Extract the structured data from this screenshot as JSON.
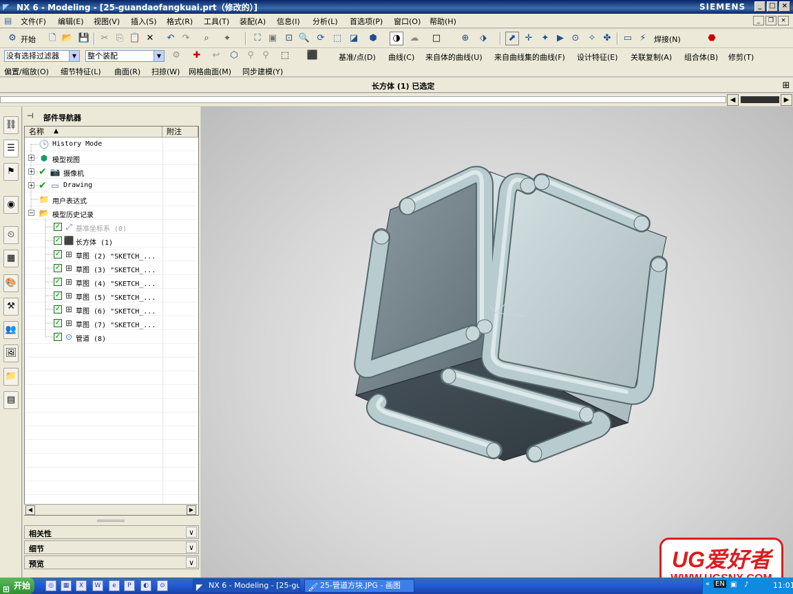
{
  "window": {
    "title": "NX 6 - Modeling - [25-guandaofangkuai.prt（修改的）]",
    "brand": "SIEMENS",
    "controls": [
      "_",
      "□",
      "×"
    ]
  },
  "menubar": {
    "items": [
      "文件(F)",
      "编辑(E)",
      "视图(V)",
      "插入(S)",
      "格式(R)",
      "工具(T)",
      "装配(A)",
      "信息(I)",
      "分析(L)",
      "首选项(P)",
      "窗口(O)",
      "帮助(H)"
    ]
  },
  "toolbar1": {
    "start_label": "开始",
    "weld_label": "焊接(N)"
  },
  "toolbar2": {
    "filter_combo": "没有选择过滤器",
    "assembly_combo": "整个装配",
    "items": [
      "基准/点(D)",
      "曲线(C)",
      "来自体的曲线(U)",
      "来自曲线集的曲线(F)",
      "设计特征(E)",
      "关联复制(A)",
      "组合体(B)",
      "修剪(T)"
    ]
  },
  "toolbar3": {
    "items": [
      "偏置/缩放(O)",
      "细节特征(L)",
      "曲面(R)",
      "扫掠(W)",
      "网格曲面(M)",
      "同步建模(Y)"
    ]
  },
  "status": {
    "message": "长方体 (1) 已选定"
  },
  "navigator": {
    "title": "部件导航器",
    "col_name": "名称",
    "col_note": "附注",
    "rows": [
      {
        "label": "History Mode",
        "icon": "clock-icon",
        "dim": false
      },
      {
        "label": "模型视图",
        "icon": "model-views-icon",
        "dim": false
      },
      {
        "label": "摄像机",
        "icon": "camera-icon",
        "dim": false
      },
      {
        "label": "Drawing",
        "icon": "drawing-icon",
        "dim": false
      },
      {
        "label": "用户表达式",
        "icon": "folder-icon",
        "dim": false
      },
      {
        "label": "模型历史记录",
        "icon": "folder-open-icon",
        "dim": false
      },
      {
        "label": "基准坐标系 (0)",
        "icon": "datum-csys-icon",
        "dim": true
      },
      {
        "label": "长方体 (1)",
        "icon": "block-icon",
        "dim": false
      },
      {
        "label": "草图 (2) \"SKETCH_...",
        "icon": "sketch-icon",
        "dim": false
      },
      {
        "label": "草图 (3) \"SKETCH_...",
        "icon": "sketch-icon",
        "dim": false
      },
      {
        "label": "草图 (4) \"SKETCH_...",
        "icon": "sketch-icon",
        "dim": false
      },
      {
        "label": "草图 (5) \"SKETCH_...",
        "icon": "sketch-icon",
        "dim": false
      },
      {
        "label": "草图 (6) \"SKETCH_...",
        "icon": "sketch-icon",
        "dim": false
      },
      {
        "label": "草图 (7) \"SKETCH_...",
        "icon": "sketch-icon",
        "dim": false
      },
      {
        "label": "管道 (8)",
        "icon": "tube-icon",
        "dim": false
      }
    ],
    "panels": [
      "相关性",
      "细节",
      "预览"
    ]
  },
  "watermark": {
    "line1": "UG爱好者",
    "line2": "WWW.UGSNX.COM"
  },
  "taskbar": {
    "start": "开始",
    "tasks": [
      "NX 6 - Modeling - [25-gu...",
      "25-管道方块.JPG - 画图"
    ],
    "lang": "EN",
    "clock": "11:01"
  },
  "colors": {
    "part_face_light": "#c4d2d4",
    "part_face_dark": "#46525a",
    "tube": "#b8cccf"
  }
}
